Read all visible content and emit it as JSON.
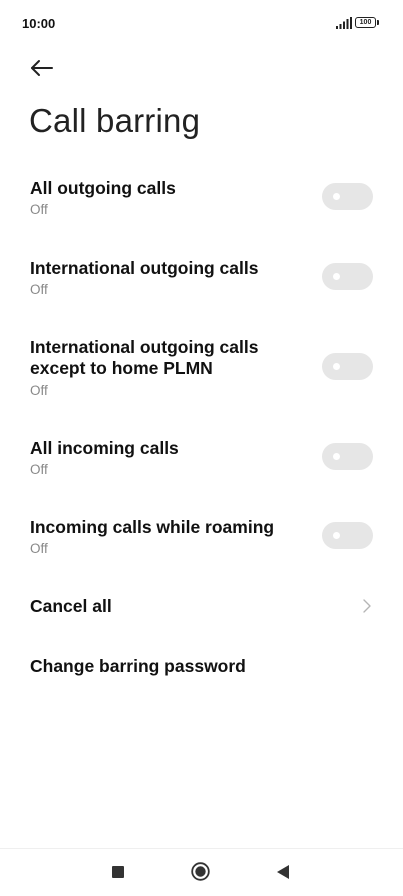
{
  "status_bar": {
    "time": "10:00",
    "battery": "100",
    "signal_icon": "signal-bars-icon"
  },
  "header": {
    "back_icon": "arrow-left-icon",
    "title": "Call barring"
  },
  "settings": {
    "items": [
      {
        "title": "All outgoing calls",
        "subtitle": "Off",
        "control": "toggle",
        "on": false
      },
      {
        "title": "International outgoing calls",
        "subtitle": "Off",
        "control": "toggle",
        "on": false
      },
      {
        "title": "International outgoing calls except to home PLMN",
        "subtitle": "Off",
        "control": "toggle",
        "on": false
      },
      {
        "title": "All incoming calls",
        "subtitle": "Off",
        "control": "toggle",
        "on": false
      },
      {
        "title": "Incoming calls while roaming",
        "subtitle": "Off",
        "control": "toggle",
        "on": false
      },
      {
        "title": "Cancel all",
        "control": "chevron"
      },
      {
        "title": "Change barring password",
        "control": "none"
      }
    ]
  },
  "nav_bar": {
    "recents_icon": "square-icon",
    "home_icon": "circle-icon",
    "back_icon": "triangle-back-icon"
  },
  "colors": {
    "toggle_off": "#e6e6e6",
    "subtitle": "#888888",
    "title": "#111111"
  }
}
